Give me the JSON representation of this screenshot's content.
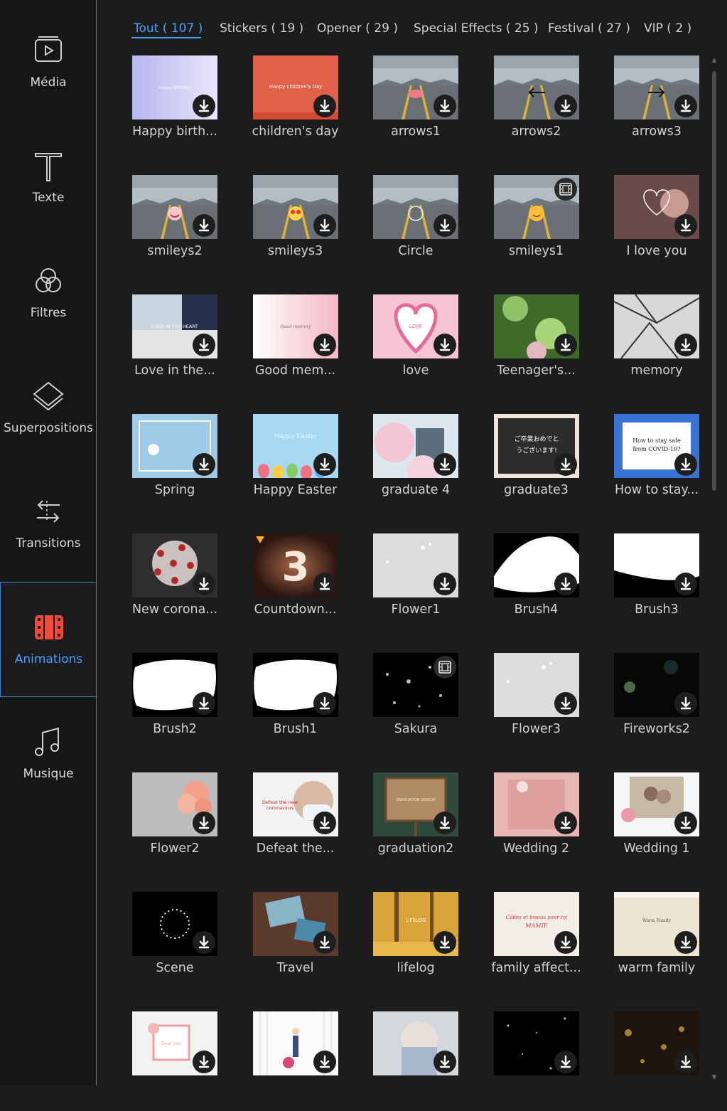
{
  "sidebar": {
    "items": [
      {
        "label": "Média",
        "icon": "media-icon",
        "active": false
      },
      {
        "label": "Texte",
        "icon": "text-icon",
        "active": false
      },
      {
        "label": "Filtres",
        "icon": "filters-icon",
        "active": false
      },
      {
        "label": "Superpositions",
        "icon": "overlays-icon",
        "active": false
      },
      {
        "label": "Transitions",
        "icon": "transitions-icon",
        "active": false
      },
      {
        "label": "Animations",
        "icon": "animations-icon",
        "active": true
      },
      {
        "label": "Musique",
        "icon": "music-icon",
        "active": false
      }
    ]
  },
  "tabs": [
    {
      "label": "Tout ( 107 )",
      "active": true
    },
    {
      "label": "Stickers ( 19 )",
      "active": false
    },
    {
      "label": "Opener ( 29 )",
      "active": false
    },
    {
      "label": "Special Effects ( 25 )",
      "active": false
    },
    {
      "label": "Festival ( 27 )",
      "active": false
    },
    {
      "label": "VIP ( 2 )",
      "active": false
    }
  ],
  "colors": {
    "accent": "#4a9fff",
    "border": "#3d7fcc",
    "background": "#1c1c1c",
    "sidebar": "#161616"
  },
  "items": [
    {
      "label": "Happy birth...",
      "thumb": "lavender",
      "overlay": "Happy birthday",
      "badge": "download"
    },
    {
      "label": "children's day",
      "thumb": "coral",
      "overlay": "Happy children's Day",
      "badge": "download"
    },
    {
      "label": "arrows1",
      "thumb": "road",
      "badge": "download"
    },
    {
      "label": "arrows2",
      "thumb": "road",
      "badge": "download"
    },
    {
      "label": "arrows3",
      "thumb": "road",
      "badge": "download"
    },
    {
      "label": "smileys2",
      "thumb": "road",
      "badge": "download"
    },
    {
      "label": "smileys3",
      "thumb": "road",
      "badge": "download"
    },
    {
      "label": "Circle",
      "thumb": "road",
      "badge": "download"
    },
    {
      "label": "smileys1",
      "thumb": "road",
      "badge": "film"
    },
    {
      "label": "I love you",
      "thumb": "rose",
      "badge": "download"
    },
    {
      "label": "Love in the...",
      "thumb": "couple",
      "overlay": "LOVE IN THE HEART",
      "badge": "download"
    },
    {
      "label": "Good mem...",
      "thumb": "blush",
      "overlay": "Good memory",
      "badge": "download"
    },
    {
      "label": "love",
      "thumb": "pink",
      "overlay": "LOVE",
      "badge": "download"
    },
    {
      "label": "Teenager's...",
      "thumb": "leaves",
      "badge": "download"
    },
    {
      "label": "memory",
      "thumb": "bw",
      "badge": "download"
    },
    {
      "label": "Spring",
      "thumb": "sky",
      "badge": "download"
    },
    {
      "label": "Happy Easter",
      "thumb": "easter",
      "overlay": "Happy Easter",
      "badge": "download"
    },
    {
      "label": "graduate 4",
      "thumb": "sakura-castle",
      "badge": "download"
    },
    {
      "label": "graduate3",
      "thumb": "chalk",
      "overlay": "ご卒業おめでとうございます!",
      "badge": "download"
    },
    {
      "label": "How to stay...",
      "thumb": "covid-note",
      "overlay": "How to stay safe from COVID-19?",
      "badge": "download"
    },
    {
      "label": "New corona...",
      "thumb": "virus",
      "badge": "download"
    },
    {
      "label": "Countdown...",
      "thumb": "countdown",
      "overlay": "3",
      "badge": "download"
    },
    {
      "label": "Flower1",
      "thumb": "lightgray",
      "badge": "download"
    },
    {
      "label": "Brush4",
      "thumb": "brush-black",
      "badge": "download"
    },
    {
      "label": "Brush3",
      "thumb": "brush-white-top",
      "badge": "download"
    },
    {
      "label": "Brush2",
      "thumb": "brush-white",
      "badge": "download"
    },
    {
      "label": "Brush1",
      "thumb": "brush-white",
      "badge": "download"
    },
    {
      "label": "Sakura",
      "thumb": "black-dots",
      "badge": "film"
    },
    {
      "label": "Flower3",
      "thumb": "lightgray",
      "badge": "download"
    },
    {
      "label": "Fireworks2",
      "thumb": "night",
      "badge": "download"
    },
    {
      "label": "Flower2",
      "thumb": "gray-flower",
      "badge": "download"
    },
    {
      "label": "Defeat the...",
      "thumb": "mask",
      "overlay": "Defeat the new coronavirus",
      "badge": "download"
    },
    {
      "label": "graduation2",
      "thumb": "board",
      "overlay": "GRADUATION SEASON",
      "badge": "download"
    },
    {
      "label": "Wedding 2",
      "thumb": "rosy",
      "badge": "download"
    },
    {
      "label": "Wedding 1",
      "thumb": "photo-frame",
      "badge": "download"
    },
    {
      "label": "Scene",
      "thumb": "ring",
      "badge": "download"
    },
    {
      "label": "Travel",
      "thumb": "travel",
      "badge": "download"
    },
    {
      "label": "lifelog",
      "thumb": "autumn",
      "overlay": "LIFELOG",
      "badge": "download"
    },
    {
      "label": "family affect...",
      "thumb": "cream",
      "overlay": "Câlins et bisous pour toi MAMIE",
      "badge": "download"
    },
    {
      "label": "warm family",
      "thumb": "paper",
      "overlay": "Warm Family",
      "badge": "download"
    },
    {
      "label": "",
      "thumb": "floral-frame",
      "overlay": "Dear you",
      "badge": "download"
    },
    {
      "label": "",
      "thumb": "card-couple",
      "badge": "download"
    },
    {
      "label": "",
      "thumb": "denim",
      "badge": "download"
    },
    {
      "label": "",
      "thumb": "black-stars",
      "badge": "download"
    },
    {
      "label": "",
      "thumb": "bokeh",
      "badge": "download"
    }
  ]
}
